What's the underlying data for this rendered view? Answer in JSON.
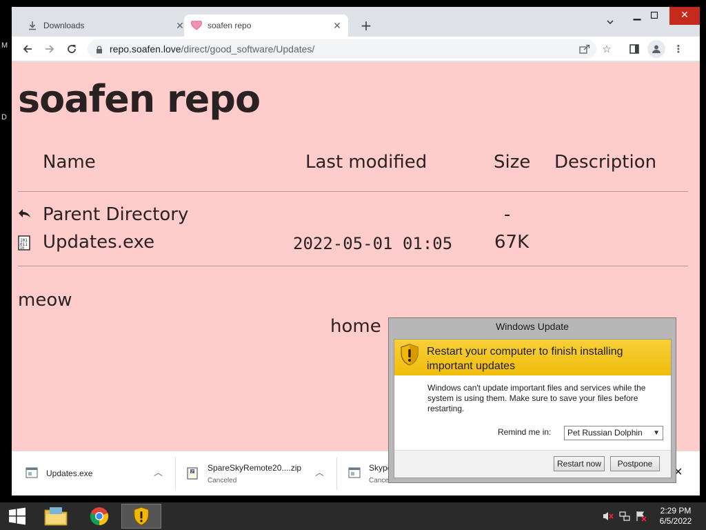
{
  "desktop": {
    "glyph_top": "M",
    "glyph_mid": "D"
  },
  "tabs": [
    {
      "label": "Downloads",
      "icon": "download-icon"
    },
    {
      "label": "soafen repo",
      "icon": "heart-icon"
    }
  ],
  "url": {
    "host": "repo.soafen.love",
    "path": "/direct/good_software/Updates/"
  },
  "page": {
    "title": "soafen repo",
    "columns": {
      "name": "Name",
      "modified": "Last modified",
      "size": "Size",
      "description": "Description"
    },
    "rows": [
      {
        "name": "Parent Directory",
        "modified": "",
        "size": "-",
        "icon": "back-arrow-icon"
      },
      {
        "name": "Updates.exe",
        "modified": "2022-05-01 01:05",
        "size": "67K",
        "icon": "binary-file-icon"
      }
    ],
    "footer_text": "meow",
    "home_link": "home"
  },
  "downloads": [
    {
      "name": "Updates.exe",
      "status": ""
    },
    {
      "name": "SpareSkyRemote20....zip",
      "status": "Canceled"
    },
    {
      "name": "Skype",
      "status": "Cancel"
    }
  ],
  "dialog": {
    "title": "Windows Update",
    "heading": "Restart your computer to finish installing important updates",
    "body": "Windows can't update important files and services while the system is using them. Make sure to save your files before restarting.",
    "remind_label": "Remind me in:",
    "remind_value": "Pet Russian Dolphin",
    "restart_label": "Restart now",
    "postpone_label": "Postpone"
  },
  "clock": {
    "time": "2:29 PM",
    "date": "6/5/2022"
  },
  "colors": {
    "page_bg": "#ffcccc",
    "banner": "#f5c518",
    "taskbar": "#2a2a2a"
  }
}
